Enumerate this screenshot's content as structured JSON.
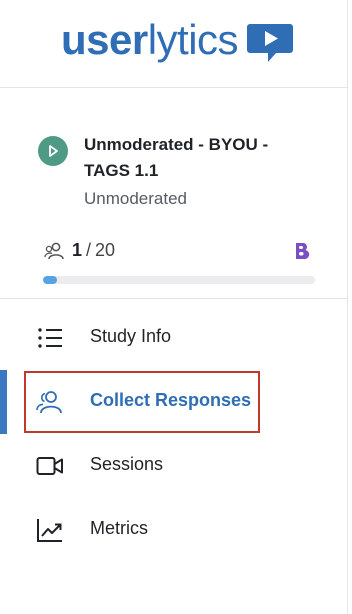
{
  "brand": {
    "name_bold": "user",
    "name_light": "lytics",
    "accent": "#2f6db5"
  },
  "study": {
    "title": "Unmoderated - BYOU - TAGS 1.1",
    "type": "Unmoderated",
    "status_icon": "play-icon",
    "participants_current": "1",
    "participants_total": "20",
    "progress_fraction": 0.05,
    "badge_icon": "b-icon"
  },
  "nav": {
    "items": [
      {
        "label": "Study Info",
        "icon": "list-icon"
      },
      {
        "label": "Collect Responses",
        "icon": "users-icon"
      },
      {
        "label": "Sessions",
        "icon": "video-camera-icon"
      },
      {
        "label": "Metrics",
        "icon": "chart-icon"
      }
    ],
    "active_index": 1
  },
  "colors": {
    "status_green": "#4f9a84",
    "progress_blue": "#55a3e2",
    "highlight_red": "#c0392b",
    "badge_purple": "#7b4fc4"
  }
}
